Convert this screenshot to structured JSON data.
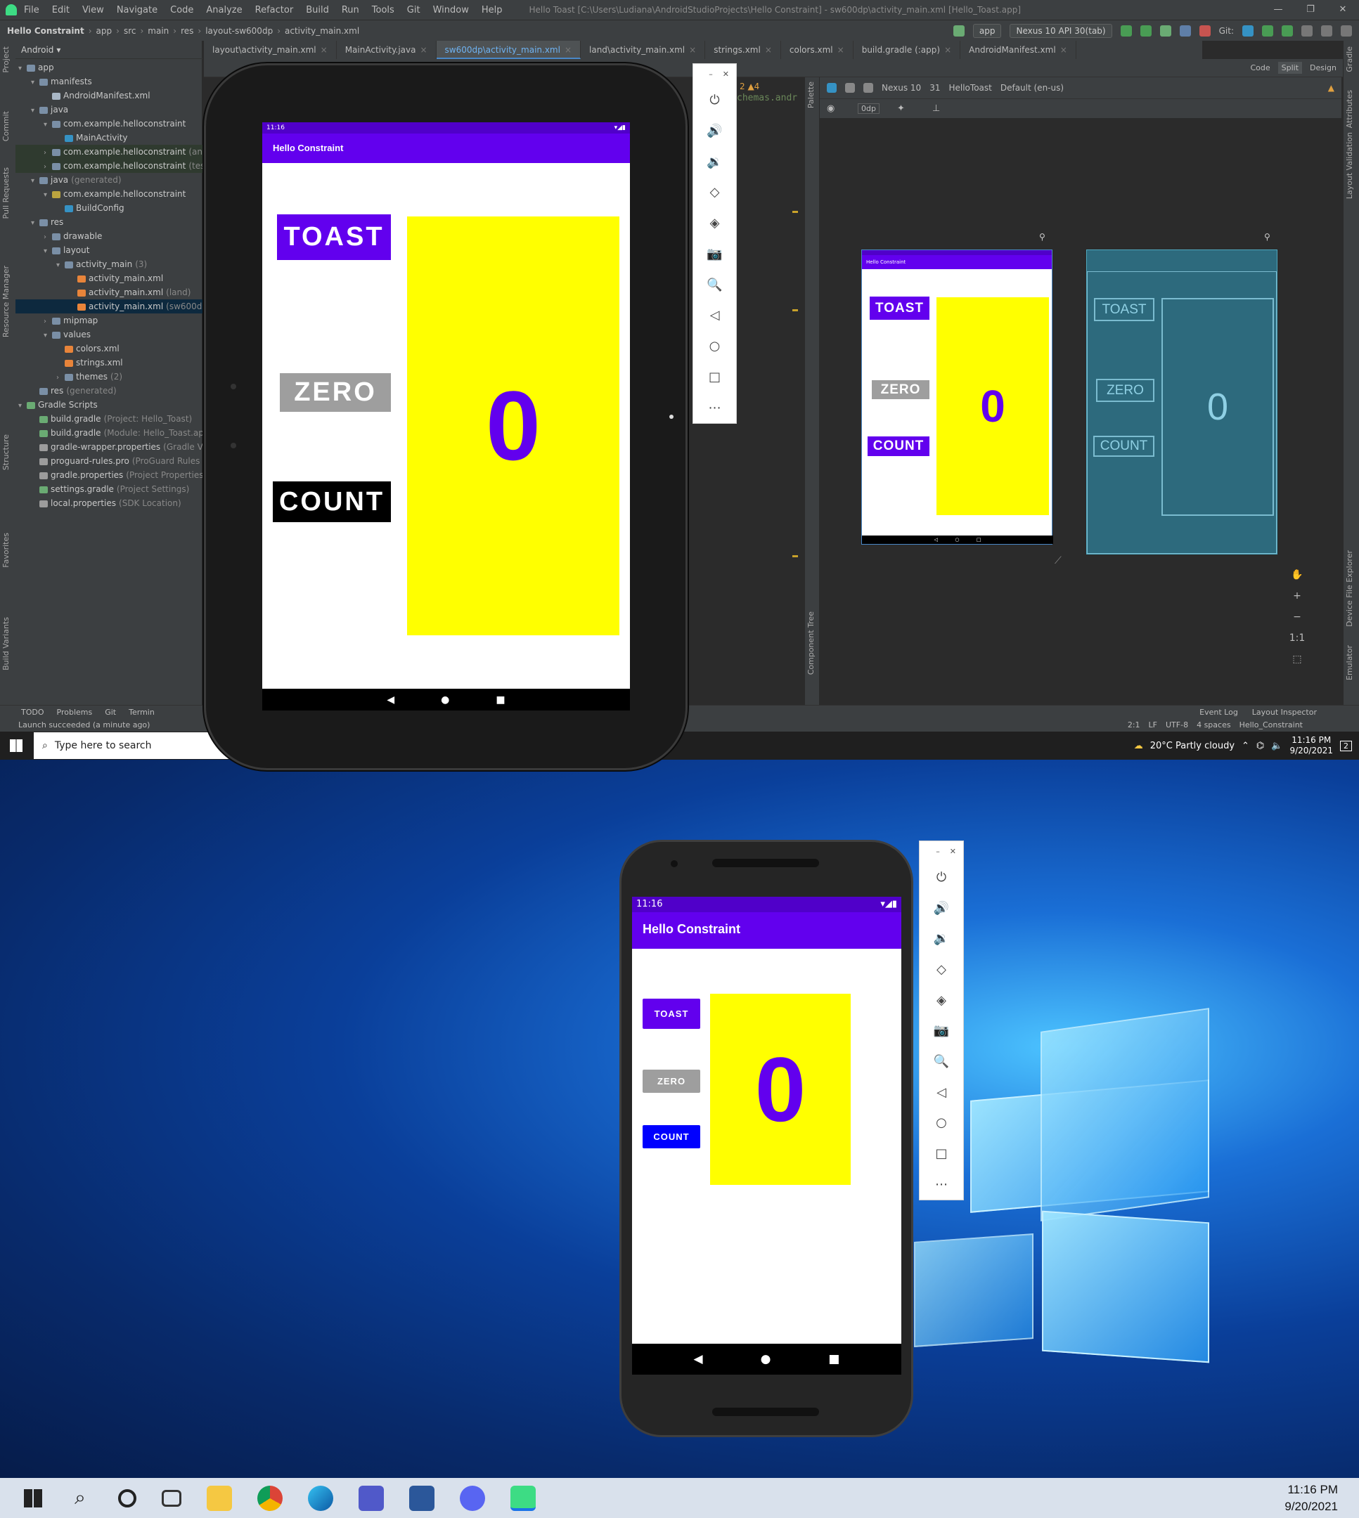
{
  "ide": {
    "menu": [
      "File",
      "Edit",
      "View",
      "Navigate",
      "Code",
      "Analyze",
      "Refactor",
      "Build",
      "Run",
      "Tools",
      "Git",
      "Window",
      "Help"
    ],
    "window_title": "Hello Toast [C:\\Users\\Ludiana\\AndroidStudioProjects\\Hello Constraint] - sw600dp\\activity_main.xml [Hello_Toast.app]",
    "breadcrumb": [
      "Hello Constraint",
      "app",
      "src",
      "main",
      "res",
      "layout-sw600dp",
      "activity_main.xml"
    ],
    "run_config": "app",
    "device_config": "Nexus 10 API 30(tab)",
    "git_label": "Git:",
    "project_view": "Android",
    "tree": [
      {
        "label": "app",
        "extra": "",
        "depth": 0,
        "arrow": "▾",
        "color": "#7a8fa6",
        "cls": ""
      },
      {
        "label": "manifests",
        "extra": "",
        "depth": 1,
        "arrow": "▾",
        "color": "#7a8fa6",
        "cls": ""
      },
      {
        "label": "AndroidManifest.xml",
        "extra": "",
        "depth": 2,
        "arrow": "",
        "color": "#a9b7c6",
        "cls": ""
      },
      {
        "label": "java",
        "extra": "",
        "depth": 1,
        "arrow": "▾",
        "color": "#7a8fa6",
        "cls": ""
      },
      {
        "label": "com.example.helloconstraint",
        "extra": "",
        "depth": 2,
        "arrow": "▾",
        "color": "#7a8fa6",
        "cls": ""
      },
      {
        "label": "MainActivity",
        "extra": "",
        "depth": 3,
        "arrow": "",
        "color": "#3592c4",
        "cls": ""
      },
      {
        "label": "com.example.helloconstraint",
        "extra": "(andr",
        "depth": 2,
        "arrow": "›",
        "color": "#7a8fa6",
        "cls": "hl"
      },
      {
        "label": "com.example.helloconstraint",
        "extra": "(test)",
        "depth": 2,
        "arrow": "›",
        "color": "#7a8fa6",
        "cls": "hl"
      },
      {
        "label": "java",
        "extra": "(generated)",
        "depth": 1,
        "arrow": "▾",
        "color": "#7a8fa6",
        "cls": ""
      },
      {
        "label": "com.example.helloconstraint",
        "extra": "",
        "depth": 2,
        "arrow": "▾",
        "color": "#bba43f",
        "cls": ""
      },
      {
        "label": "BuildConfig",
        "extra": "",
        "depth": 3,
        "arrow": "",
        "color": "#3592c4",
        "cls": ""
      },
      {
        "label": "res",
        "extra": "",
        "depth": 1,
        "arrow": "▾",
        "color": "#7a8fa6",
        "cls": ""
      },
      {
        "label": "drawable",
        "extra": "",
        "depth": 2,
        "arrow": "›",
        "color": "#7a8fa6",
        "cls": ""
      },
      {
        "label": "layout",
        "extra": "",
        "depth": 2,
        "arrow": "▾",
        "color": "#7a8fa6",
        "cls": ""
      },
      {
        "label": "activity_main",
        "extra": "(3)",
        "depth": 3,
        "arrow": "▾",
        "color": "#7a8fa6",
        "cls": ""
      },
      {
        "label": "activity_main.xml",
        "extra": "",
        "depth": 4,
        "arrow": "",
        "color": "#e8843a",
        "cls": ""
      },
      {
        "label": "activity_main.xml",
        "extra": "(land)",
        "depth": 4,
        "arrow": "",
        "color": "#e8843a",
        "cls": ""
      },
      {
        "label": "activity_main.xml",
        "extra": "(sw600dp)",
        "depth": 4,
        "arrow": "",
        "color": "#e8843a",
        "cls": "sel"
      },
      {
        "label": "mipmap",
        "extra": "",
        "depth": 2,
        "arrow": "›",
        "color": "#7a8fa6",
        "cls": ""
      },
      {
        "label": "values",
        "extra": "",
        "depth": 2,
        "arrow": "▾",
        "color": "#7a8fa6",
        "cls": ""
      },
      {
        "label": "colors.xml",
        "extra": "",
        "depth": 3,
        "arrow": "",
        "color": "#e8843a",
        "cls": ""
      },
      {
        "label": "strings.xml",
        "extra": "",
        "depth": 3,
        "arrow": "",
        "color": "#e8843a",
        "cls": ""
      },
      {
        "label": "themes",
        "extra": "(2)",
        "depth": 3,
        "arrow": "›",
        "color": "#7a8fa6",
        "cls": ""
      },
      {
        "label": "res",
        "extra": "(generated)",
        "depth": 1,
        "arrow": "",
        "color": "#7a8fa6",
        "cls": ""
      },
      {
        "label": "Gradle Scripts",
        "extra": "",
        "depth": 0,
        "arrow": "▾",
        "color": "#6aab73",
        "cls": ""
      },
      {
        "label": "build.gradle",
        "extra": "(Project: Hello_Toast)",
        "depth": 1,
        "arrow": "",
        "color": "#6aab73",
        "cls": ""
      },
      {
        "label": "build.gradle",
        "extra": "(Module: Hello_Toast.app)",
        "depth": 1,
        "arrow": "",
        "color": "#6aab73",
        "cls": ""
      },
      {
        "label": "gradle-wrapper.properties",
        "extra": "(Gradle Vers",
        "depth": 1,
        "arrow": "",
        "color": "#9c9c9c",
        "cls": ""
      },
      {
        "label": "proguard-rules.pro",
        "extra": "(ProGuard Rules fo",
        "depth": 1,
        "arrow": "",
        "color": "#9c9c9c",
        "cls": ""
      },
      {
        "label": "gradle.properties",
        "extra": "(Project Properties)",
        "depth": 1,
        "arrow": "",
        "color": "#9c9c9c",
        "cls": ""
      },
      {
        "label": "settings.gradle",
        "extra": "(Project Settings)",
        "depth": 1,
        "arrow": "",
        "color": "#6aab73",
        "cls": ""
      },
      {
        "label": "local.properties",
        "extra": "(SDK Location)",
        "depth": 1,
        "arrow": "",
        "color": "#9c9c9c",
        "cls": ""
      }
    ],
    "tabs": [
      "layout\\activity_main.xml",
      "MainActivity.java",
      "sw600dp\\activity_main.xml",
      "land\\activity_main.xml",
      "strings.xml",
      "colors.xml",
      "build.gradle (:app)",
      "AndroidManifest.xml"
    ],
    "active_tab_index": 2,
    "view_modes": [
      "Code",
      "Split",
      "Design"
    ],
    "code_snippet": "chemas.andr",
    "problems": "2 ▲4",
    "design_toolbar": {
      "device": "Nexus 10",
      "api": "31",
      "theme": "HelloToast",
      "locale": "Default (en-us)",
      "margin": "0dp"
    },
    "left_vtabs": [
      "Project",
      "Commit",
      "Pull Requests",
      "Resource Manager",
      "Structure",
      "Favorites",
      "Build Variants"
    ],
    "right_vtabs": [
      "Gradle",
      "Attributes",
      "Layout Validation",
      "Device File Explorer",
      "Emulator"
    ],
    "palette_tabs": [
      "Palette",
      "Component Tree"
    ],
    "zoom_controls": [
      "✋",
      "+",
      "−",
      "1:1",
      "⬚"
    ],
    "bottom_tools": [
      "TODO",
      "Problems",
      "Git",
      "Termin"
    ],
    "bottom_right_tools": [
      "Event Log",
      "Layout Inspector"
    ],
    "status_msg": "Launch succeeded (a minute ago)",
    "status_right": [
      "2:1",
      "LF",
      "UTF-8",
      "4 spaces",
      "Hello_Constraint"
    ]
  },
  "app": {
    "title": "Hello Constraint",
    "time": "11:16",
    "toast": "TOAST",
    "zero": "ZERO",
    "count": "COUNT",
    "counter": "0",
    "colors": {
      "primary": "#6200ee",
      "status": "#5000c9",
      "counter_bg": "#ffff00",
      "zero_btn": "#9e9e9e",
      "count_tablet": "#000000",
      "count_phone": "#0000ff"
    }
  },
  "preview": {
    "title": "Hello Constraint",
    "time": "11:16",
    "toast": "TOAST",
    "zero": "ZERO",
    "count": "COUNT",
    "counter": "0"
  },
  "blueprint": {
    "toast": "TOAST",
    "zero": "ZERO",
    "count": "COUNT",
    "counter": "0"
  },
  "emulator_controls": [
    "power-icon",
    "volume-up-icon",
    "volume-down-icon",
    "rotate-left-icon",
    "rotate-right-icon",
    "camera-icon",
    "zoom-icon",
    "back-icon",
    "home-icon",
    "overview-icon",
    "more-icon"
  ],
  "emulator_glyphs": [
    "⏻",
    "🔊",
    "🔉",
    "◇",
    "◈",
    "📷",
    "🔍",
    "◁",
    "○",
    "□",
    "⋯"
  ],
  "nav_glyphs": [
    "◀",
    "●",
    "■"
  ],
  "taskbar_top": {
    "search_placeholder": "Type here to search",
    "weather": "20°C  Partly cloudy",
    "time": "11:16 PM",
    "date": "9/20/2021",
    "notif": "2"
  },
  "taskbar_bottom": {
    "time": "11:16 PM",
    "date": "9/20/2021"
  }
}
